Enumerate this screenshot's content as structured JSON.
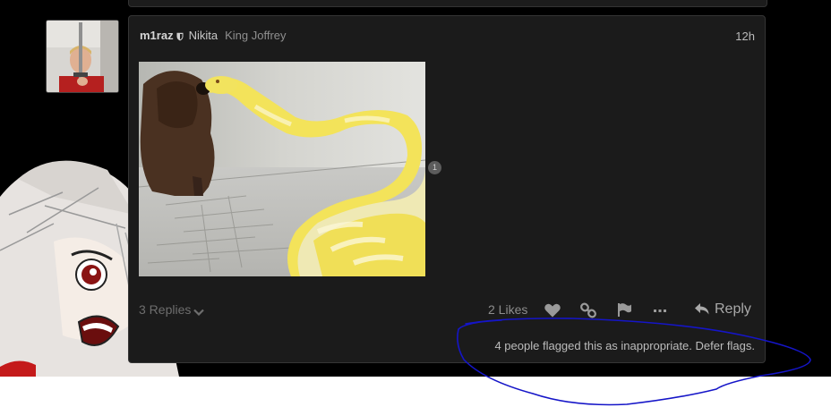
{
  "post": {
    "username": "m1raz",
    "full_name": "Nikita",
    "user_title": "King Joffrey",
    "timestamp": "12h",
    "link_click_count": "1",
    "replies_label": "3 Replies",
    "likes_label": "2 Likes",
    "reply_label": "Reply",
    "flag_notice": "4 people flagged this as inappropriate. Defer flags."
  },
  "icons": {
    "moderator": "shield-icon",
    "replies_toggle": "chevron-down-icon",
    "like": "heart-icon",
    "share": "link-icon",
    "flag": "flag-icon",
    "more": "ellipsis-icon",
    "reply": "reply-arrow-icon"
  },
  "colors": {
    "page_background": "#000000",
    "post_background": "#1b1b1b",
    "post_border": "#353535",
    "annotation_ink": "#1515c8"
  }
}
